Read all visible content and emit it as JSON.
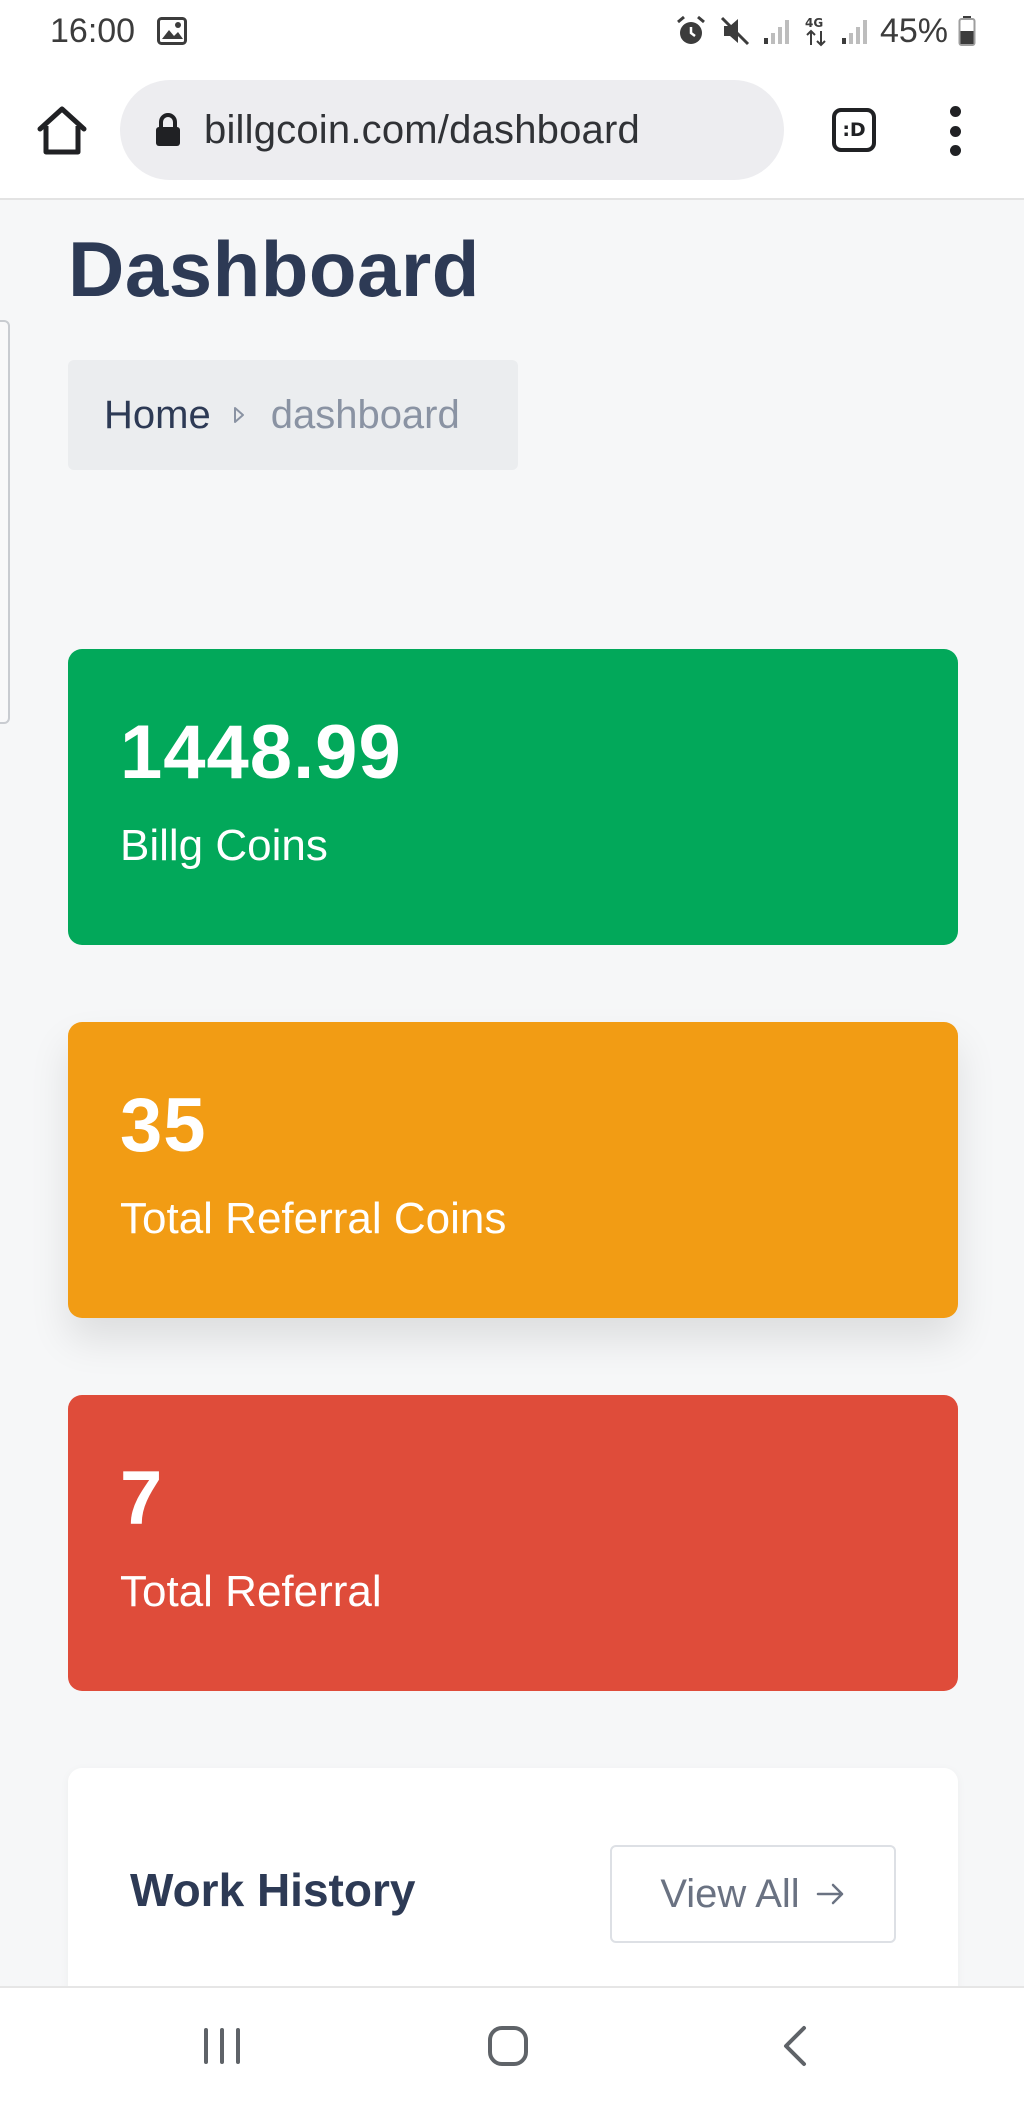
{
  "status_bar": {
    "time": "16:00",
    "battery": "45%",
    "icons": [
      "image-icon",
      "alarm-icon",
      "mute-icon",
      "signal-icon",
      "4g-icon",
      "signal-icon",
      "battery-icon"
    ]
  },
  "browser": {
    "url": "billgcoin.com/dashboard",
    "tab_label": ":D"
  },
  "page": {
    "title": "Dashboard",
    "breadcrumb": {
      "home": "Home",
      "current": "dashboard"
    }
  },
  "stats": [
    {
      "value": "1448.99",
      "label": "Billg Coins",
      "color": "#02a85a"
    },
    {
      "value": "35",
      "label": "Total Referral Coins",
      "color": "#f29c14"
    },
    {
      "value": "7",
      "label": "Total Referral",
      "color": "#df4c3a"
    }
  ],
  "work_history": {
    "title": "Work History",
    "view_all": "View All"
  },
  "nav": {
    "icons": [
      "recent-apps-icon",
      "home-icon",
      "back-icon"
    ]
  }
}
